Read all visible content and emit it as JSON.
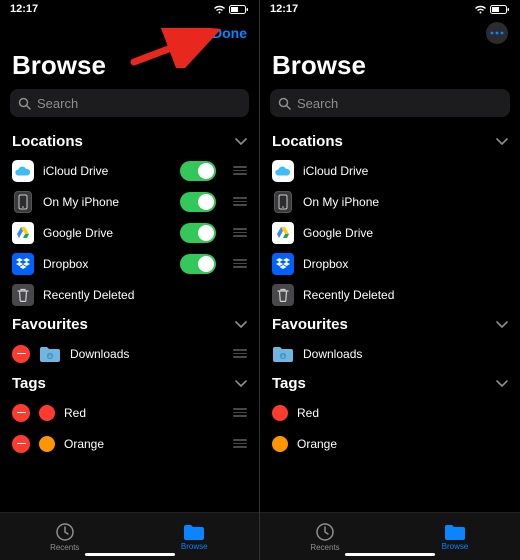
{
  "status": {
    "time": "12:17"
  },
  "nav": {
    "done": "Done"
  },
  "title": "Browse",
  "search": {
    "placeholder": "Search"
  },
  "sections": {
    "locations": {
      "label": "Locations"
    },
    "favourites": {
      "label": "Favourites"
    },
    "tags": {
      "label": "Tags"
    }
  },
  "locations": [
    {
      "name": "iCloud Drive"
    },
    {
      "name": "On My iPhone"
    },
    {
      "name": "Google Drive"
    },
    {
      "name": "Dropbox"
    },
    {
      "name": "Recently Deleted"
    }
  ],
  "favourites": [
    {
      "name": "Downloads"
    }
  ],
  "tags": [
    {
      "name": "Red",
      "color": "#ff3b30"
    },
    {
      "name": "Orange",
      "color": "#ff9500"
    }
  ],
  "tabs": {
    "recents": "Recents",
    "browse": "Browse"
  }
}
